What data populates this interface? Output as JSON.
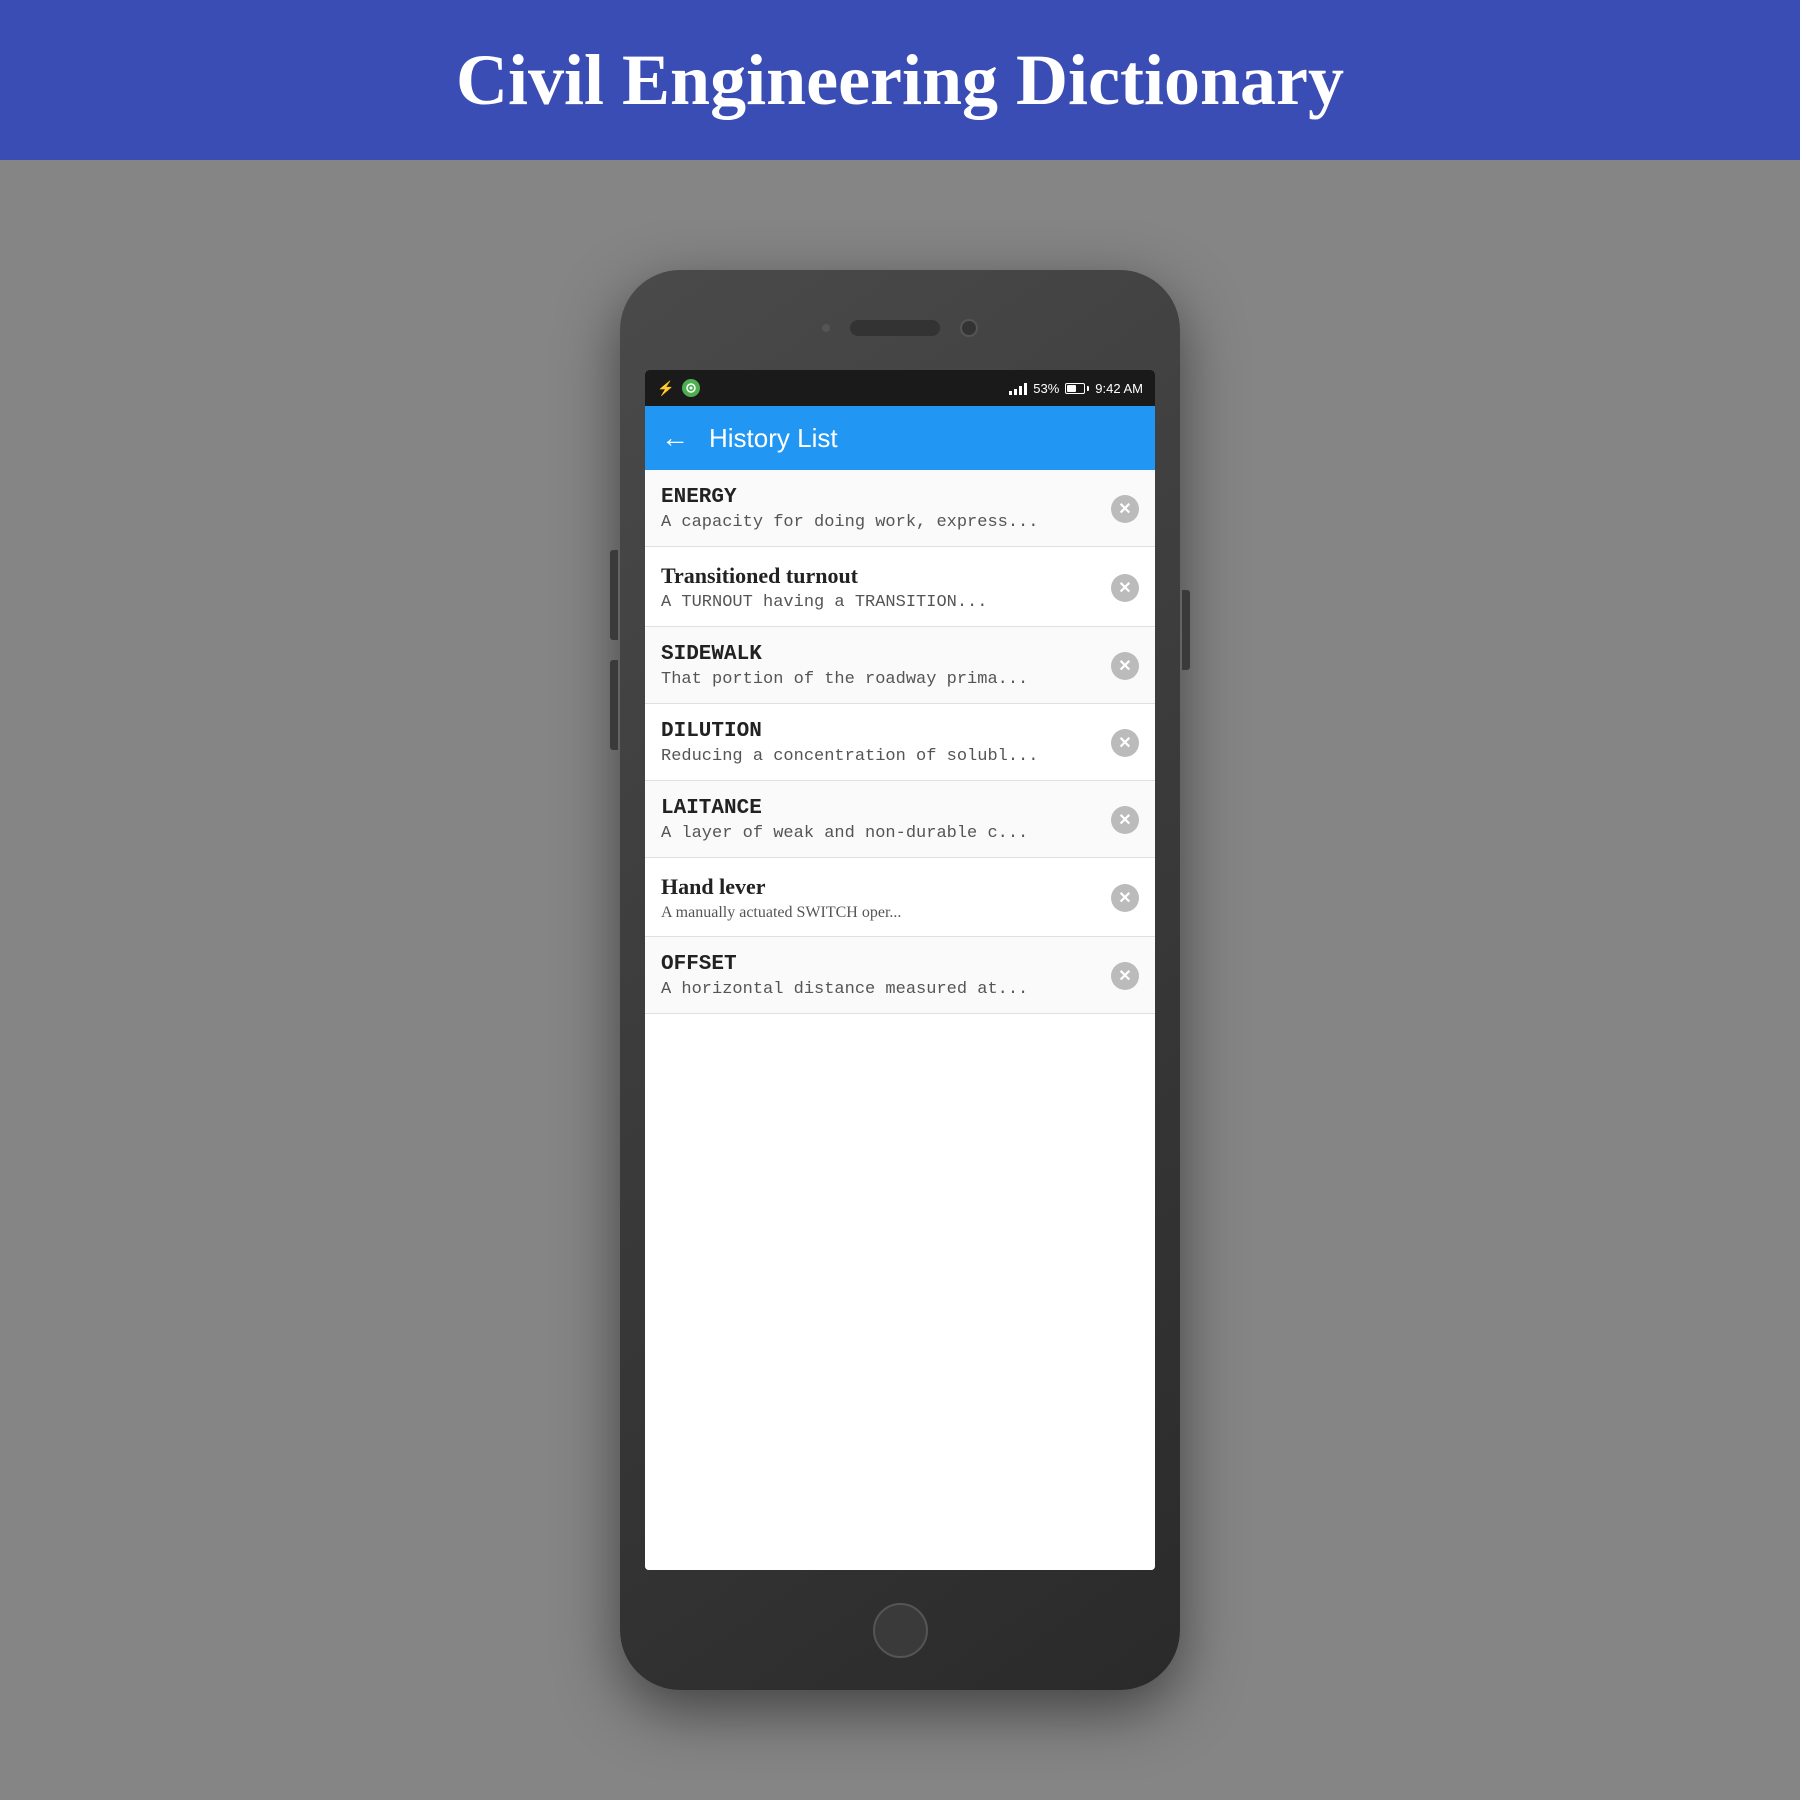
{
  "banner": {
    "title": "Civil Engineering Dictionary"
  },
  "statusBar": {
    "battery": "53%",
    "time": "9:42 AM"
  },
  "appBar": {
    "backLabel": "←",
    "title": "History List"
  },
  "listItems": [
    {
      "title": "ENERGY",
      "subtitle": "A capacity for doing work, express...",
      "titleStyle": "mono",
      "subtitleStyle": "mono"
    },
    {
      "title": "Transitioned turnout",
      "subtitle": "A TURNOUT having a TRANSITION...",
      "titleStyle": "bold",
      "subtitleStyle": "mono"
    },
    {
      "title": "SIDEWALK",
      "subtitle": "That portion of the roadway prima...",
      "titleStyle": "mono",
      "subtitleStyle": "mono"
    },
    {
      "title": "DILUTION",
      "subtitle": "Reducing a concentration of solubl...",
      "titleStyle": "mono",
      "subtitleStyle": "mono"
    },
    {
      "title": "LAITANCE",
      "subtitle": "A layer of weak and non-durable c...",
      "titleStyle": "mono",
      "subtitleStyle": "mono"
    },
    {
      "title": "Hand lever",
      "subtitle": "A manually actuated SWITCH oper...",
      "titleStyle": "handwriting",
      "subtitleStyle": "handwriting"
    },
    {
      "title": "OFFSET",
      "subtitle": "A horizontal distance measured at...",
      "titleStyle": "mono",
      "subtitleStyle": "mono"
    }
  ],
  "icons": {
    "close": "✕",
    "back": "←",
    "usb": "⚡"
  }
}
